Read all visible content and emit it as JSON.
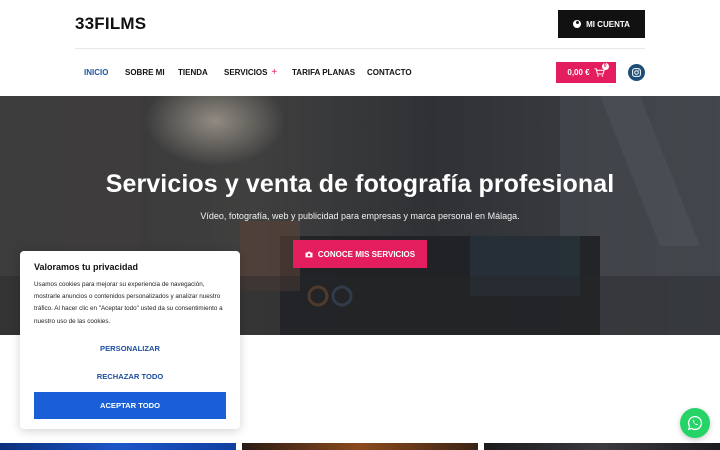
{
  "header": {
    "logo": "33FILMS",
    "account_label": "MI CUENTA"
  },
  "nav": {
    "items": [
      "INICIO",
      "SOBRE MI",
      "TIENDA",
      "SERVICIOS",
      "TARIFA PLANAS",
      "CONTACTO"
    ],
    "services_plus": "+",
    "active_item": "INICIO"
  },
  "cart": {
    "total": "0,00 €",
    "count": "0"
  },
  "hero": {
    "title": "Servicios y venta de fotografía profesional",
    "subtitle": "Vídeo, fotografía, web y publicidad para empresas y marca personal en Málaga.",
    "cta_label": "CONOCE MIS SERVICIOS"
  },
  "cookie": {
    "title": "Valoramos tu privacidad",
    "text": "Usamos cookies para mejorar su experiencia de navegación, mostrarle anuncios o contenidos personalizados y analizar nuestro tráfico. Al hacer clic en \"Aceptar todo\" usted da su consentimiento a nuestro uso de las cookies.",
    "customize_label": "PERSONALIZAR",
    "reject_label": "RECHAZAR TODO",
    "accept_label": "ACEPTAR TODO"
  },
  "icons": {
    "account": "user-circle-icon",
    "cart": "shopping-cart-icon",
    "instagram": "instagram-icon",
    "camera": "camera-icon",
    "whatsapp": "whatsapp-icon"
  },
  "colors": {
    "accent_pink": "#e31d5e",
    "nav_active": "#1b5a9e",
    "accept_blue": "#1a5fd8",
    "whatsapp_green": "#25d366",
    "instagram_blue": "#1e4e78"
  }
}
